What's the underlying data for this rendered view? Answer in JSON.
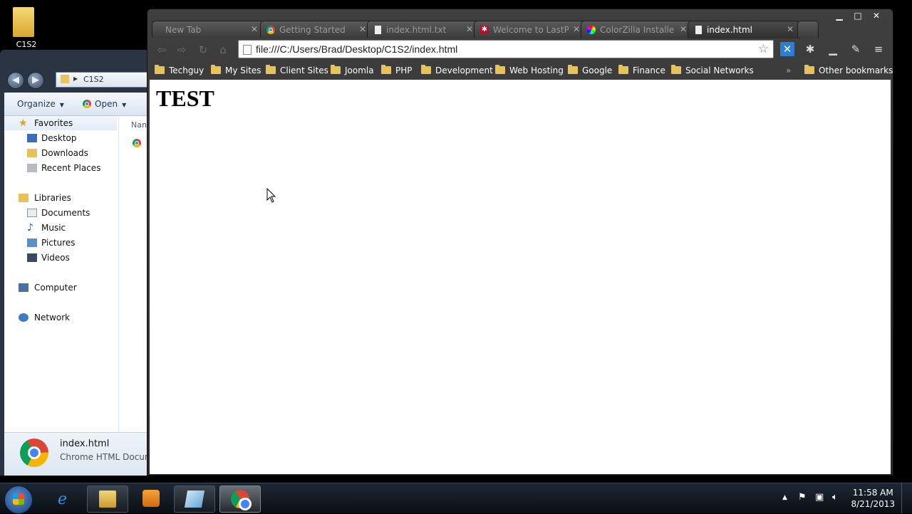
{
  "desktop": {
    "icon_label": "C1S2"
  },
  "explorer": {
    "address_crumb": "C1S2",
    "cmd_organize": "Organize",
    "cmd_open": "Open",
    "tree": [
      {
        "label": "Favorites",
        "icon": "star-icon"
      },
      {
        "label": "Desktop",
        "icon": "desktop-icon"
      },
      {
        "label": "Downloads",
        "icon": "downloads-icon"
      },
      {
        "label": "Recent Places",
        "icon": "recent-places-icon"
      },
      {
        "label": "Libraries",
        "icon": "libraries-icon"
      },
      {
        "label": "Documents",
        "icon": "documents-icon"
      },
      {
        "label": "Music",
        "icon": "music-icon"
      },
      {
        "label": "Pictures",
        "icon": "pictures-icon"
      },
      {
        "label": "Videos",
        "icon": "videos-icon"
      },
      {
        "label": "Computer",
        "icon": "computer-icon"
      },
      {
        "label": "Network",
        "icon": "network-icon"
      }
    ],
    "column_header": "Nan",
    "status_filename": "index.html",
    "status_filetype": "Chrome HTML Docum"
  },
  "chrome": {
    "tabs": [
      {
        "title": "New Tab",
        "icon": ""
      },
      {
        "title": "Getting Started",
        "icon": "chrome-icon"
      },
      {
        "title": "index.html.txt",
        "icon": "page-icon"
      },
      {
        "title": "Welcome to LastP",
        "icon": "lastpass-icon"
      },
      {
        "title": "ColorZilla Installe",
        "icon": "colorzilla-icon"
      },
      {
        "title": "index.html",
        "icon": "page-icon"
      }
    ],
    "url": "file:///C:/Users/Brad/Desktop/C1S2/index.html",
    "bookmarks": [
      "Techguy",
      "My Sites",
      "Client Sites",
      "Joomla",
      "PHP",
      "Development",
      "Web Hosting",
      "Google",
      "Finance",
      "Social Networks"
    ],
    "bookmarks_overflow": "»",
    "other_bookmarks": "Other bookmarks",
    "page_heading": "TEST"
  },
  "taskbar": {
    "time": "11:58 AM",
    "date": "8/21/2013"
  },
  "colors": {
    "accent": "#4285f4",
    "chrome_frame": "#3a3a3a",
    "taskbar": "#131a24"
  }
}
